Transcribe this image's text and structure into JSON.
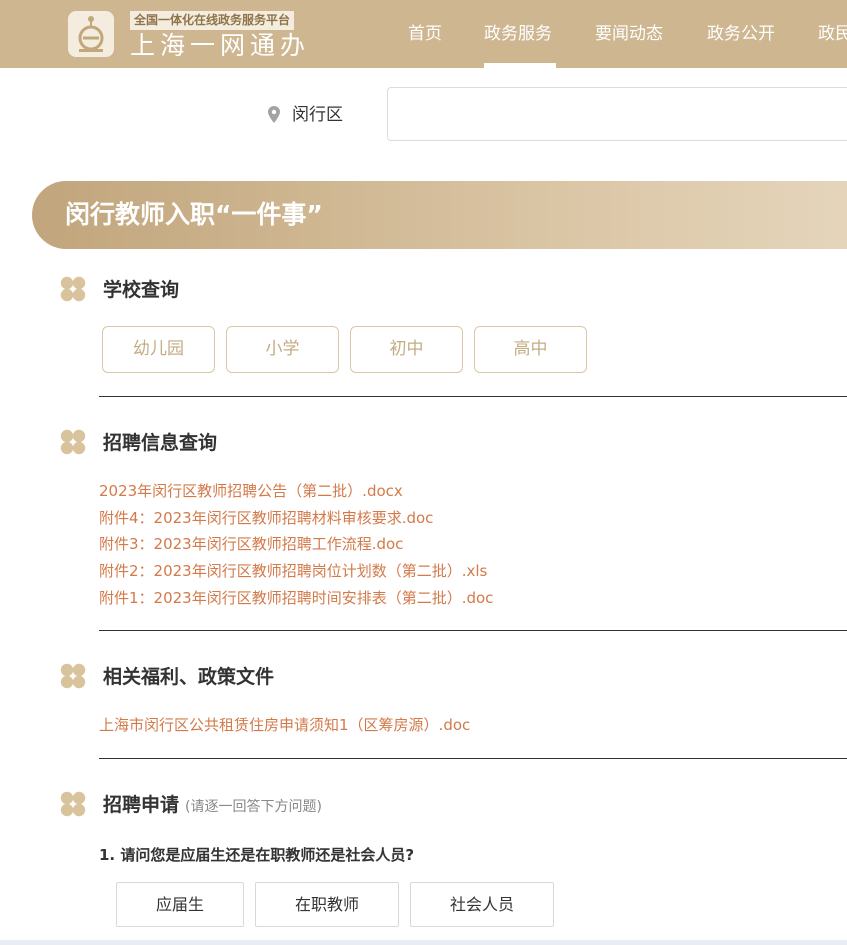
{
  "header": {
    "logo_subtitle": "全国一体化在线政务服务平台",
    "logo_title": "上海一网通办",
    "nav": [
      {
        "label": "首页"
      },
      {
        "label": "政务服务"
      },
      {
        "label": "要闻动态"
      },
      {
        "label": "政务公开"
      },
      {
        "label": "政民"
      }
    ],
    "active_nav": "政务服务"
  },
  "location": {
    "district": "闵行区",
    "search_value": ""
  },
  "banner": {
    "title": "闵行教师入职“一件事”"
  },
  "sections": {
    "school_query": {
      "title": "学校查询",
      "buttons": [
        "幼儿园",
        "小学",
        "初中",
        "高中"
      ]
    },
    "recruit_info": {
      "title": "招聘信息查询",
      "links": [
        "2023年闵行区教师招聘公告（第二批）.docx",
        "附件4：2023年闵行区教师招聘材料审核要求.doc",
        "附件3：2023年闵行区教师招聘工作流程.doc",
        "附件2：2023年闵行区教师招聘岗位计划数（第二批）.xls",
        "附件1：2023年闵行区教师招聘时间安排表（第二批）.doc"
      ]
    },
    "welfare": {
      "title": "相关福利、政策文件",
      "links": [
        "上海市闵行区公共租赁住房申请须知1（区筹房源）.doc"
      ]
    },
    "apply": {
      "title": "招聘申请",
      "hint": "(请逐一回答下方问题)",
      "question": "1. 请问您是应届生还是在职教师还是社会人员?",
      "answers": [
        "应届生",
        "在职教师",
        "社会人员"
      ]
    }
  },
  "colors": {
    "header_bg": "#cdb690",
    "accent_gold": "#c3ad85",
    "link_orange": "#d47a4a",
    "icon_gold": "#d8c39c"
  }
}
